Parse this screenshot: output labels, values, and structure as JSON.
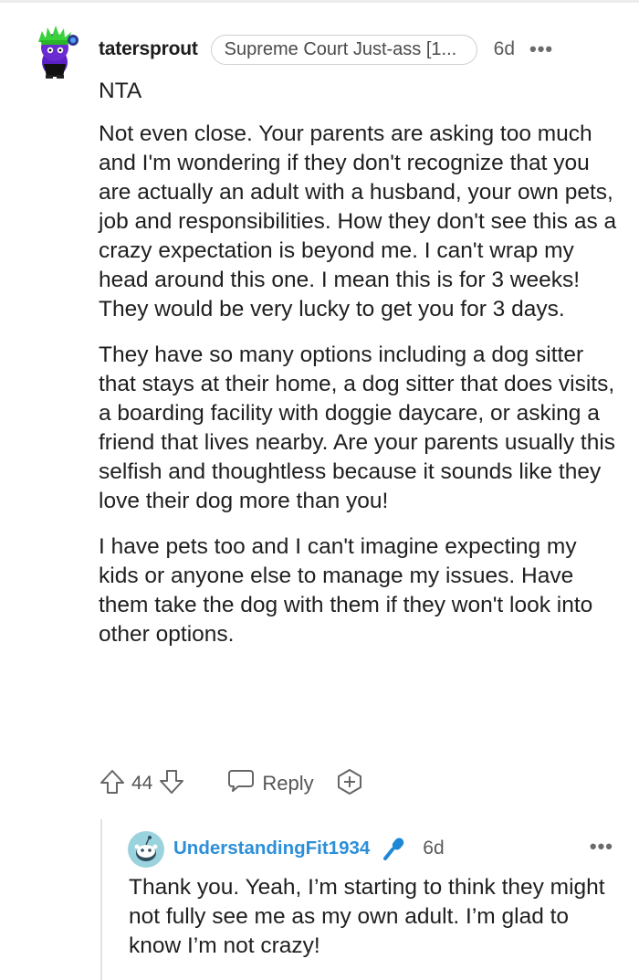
{
  "comment": {
    "username": "tatersprout",
    "flair": "Supreme Court Just-ass [1...",
    "time": "6d",
    "more": "•••",
    "paragraphs": [
      "NTA",
      "Not even close. Your parents are asking too much and I'm wondering if they don't recognize that you are actually an adult with a husband, your own pets, job and responsibilities. How they don't see this as a crazy expectation is beyond me. I can't wrap my head around this one. I mean this is for 3 weeks! They would be very lucky to get you for 3 days.",
      "They have so many options including a dog sitter that stays at their home, a dog sitter that does visits, a boarding facility with doggie daycare, or asking a friend that lives nearby. Are your parents usually this selfish and thoughtless because it sounds like they love their dog more than you!",
      "I have pets too and I can't imagine expecting my kids or anyone else to manage my issues. Have them take the dog with them if they won't look into other options."
    ],
    "actions": {
      "upvote_icon": "upvote-arrow-icon",
      "vote_count": "44",
      "downvote_icon": "downvote-arrow-icon",
      "reply_icon": "speech-bubble-icon",
      "reply_label": "Reply",
      "award_icon": "award-plus-icon"
    }
  },
  "reply": {
    "username": "UnderstandingFit1934",
    "badge_icon": "microphone-icon",
    "time": "6d",
    "more": "•••",
    "text": "Thank you. Yeah, I’m starting to think they might not fully see me as my own adult. I’m glad to know I’m not crazy!"
  },
  "colors": {
    "reply_username": "#2c8fd8",
    "mic_badge": "#1e88d6",
    "avatar_hair": "#3ad23a",
    "avatar_body": "#6a2bd1"
  }
}
